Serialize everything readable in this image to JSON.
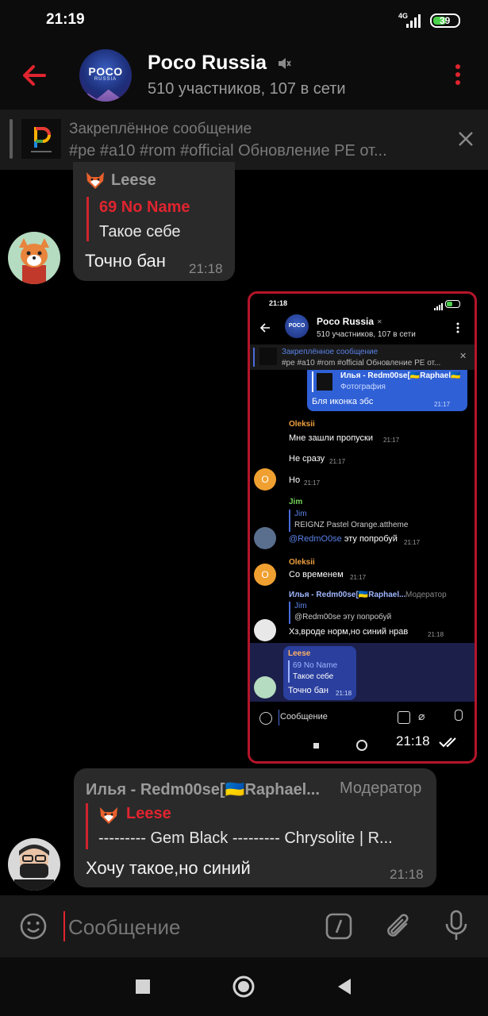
{
  "status_bar": {
    "time": "21:19",
    "network": "4G",
    "battery": "39"
  },
  "header": {
    "title": "Poco Russia",
    "subtitle": "510 участников, 107 в сети",
    "avatar_text": "POCO",
    "avatar_sub": "RUSSIA"
  },
  "pinned": {
    "title": "Закреплённое сообщение",
    "text": "#pe #a10 #rom #official  Обновление PE от..."
  },
  "messages": [
    {
      "sender": "Leese",
      "quote_sender": "69 No Name",
      "quote_text": "Такое себе",
      "text": "Точно бан",
      "time": "21:18"
    },
    {
      "sender": "Илья - Redm00se[🇺🇦Raphael...",
      "role": "Модератор",
      "quote_sender": "Leese",
      "quote_text": "--------- Gem Black --------- Chrysolite   |   R...",
      "text": "Хочу такое,но синий",
      "time": "21:18"
    }
  ],
  "screenshot": {
    "time": "21:18",
    "title": "Poco Russia",
    "subtitle": "510 участников, 107 в сети",
    "pinned_title": "Закреплённое сообщение",
    "pinned_text": "#pe #a10 #rom #official  Обновление PE от...",
    "m1_sender": "Илья - Redm00se[🇺🇦Raphael🇺🇦",
    "m1_sub": "Фотография",
    "m1_text": "Бля иконка эбс",
    "m1_time": "21:17",
    "oleksii_name": "Oleksii",
    "o1_text": "Мне зашли пропуски",
    "o1_time": "21:17",
    "o2_text": "Не сразу",
    "o2_time": "21:17",
    "o3_text": "Но",
    "o3_time": "21:17",
    "avatar_letter": "O",
    "jim_name": "Jim",
    "jim_quote_name": "Jim",
    "jim_quote_text": "REIGNZ Pastel Orange.attheme",
    "jim_mention": "@RedmO0se",
    "jim_text": " эту попробуй",
    "jim_time": "21:17",
    "o4_name": "Oleksii",
    "o4_text": "Со временем",
    "o4_time": "21:17",
    "ilya_name": "Илья - Redm00se[🇺🇦Raphael...",
    "ilya_role": "Модератор",
    "ilya_quote_name": "Jim",
    "ilya_quote_text": "@Redm00se эту попробуй",
    "ilya_text": "Хз,вроде норм,но синий нрав",
    "ilya_time": "21:18",
    "leese_name": "Leese",
    "leese_quote_name": "69 No Name",
    "leese_quote_text": "Такое себе",
    "leese_text": "Точно бан",
    "leese_time": "21:18",
    "input_placeholder": "Сообщение",
    "overlay_time": "21:18"
  },
  "input": {
    "placeholder": "Сообщение"
  },
  "colors": {
    "accent_red": "#e0242f",
    "bubble": "#2a2a2a",
    "bg": "#000000"
  }
}
